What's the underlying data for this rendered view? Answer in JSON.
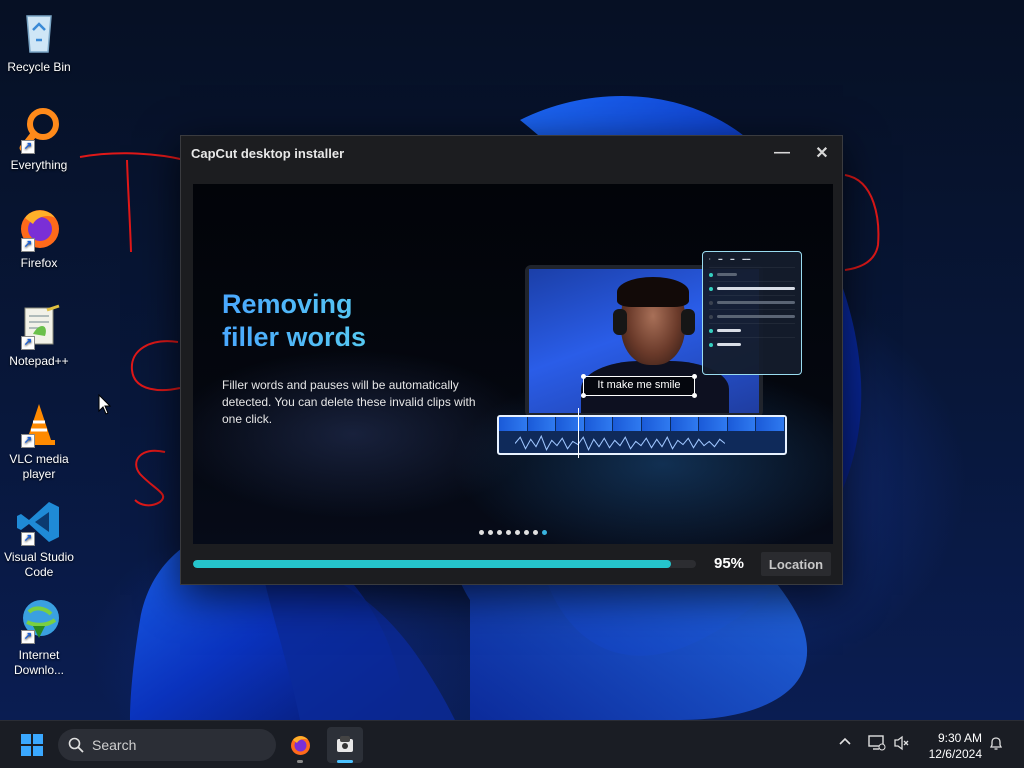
{
  "desktop": {
    "icons": [
      {
        "label": "Recycle Bin"
      },
      {
        "label": "Everything"
      },
      {
        "label": "Firefox"
      },
      {
        "label": "Notepad++"
      },
      {
        "label": "VLC media player"
      },
      {
        "label": "Visual Studio Code"
      },
      {
        "label": "Internet Downlo..."
      }
    ]
  },
  "installer": {
    "title": "CapCut desktop installer",
    "minimize_icon": "minimize-icon",
    "close_icon": "close-icon",
    "slide": {
      "headline_line1": "Removing",
      "headline_line2": "filler words",
      "body": "Filler words and pauses will be automatically detected. You can delete these invalid clips with one click.",
      "caption": "It make me smile",
      "pager_total": 8,
      "pager_active": 8
    },
    "progress_percent": 95,
    "progress_label": "95%",
    "location_button": "Location",
    "accent_color": "#25c4cc"
  },
  "taskbar": {
    "search_placeholder": "Search",
    "clock_time": "9:30 AM",
    "clock_date": "12/6/2024"
  }
}
